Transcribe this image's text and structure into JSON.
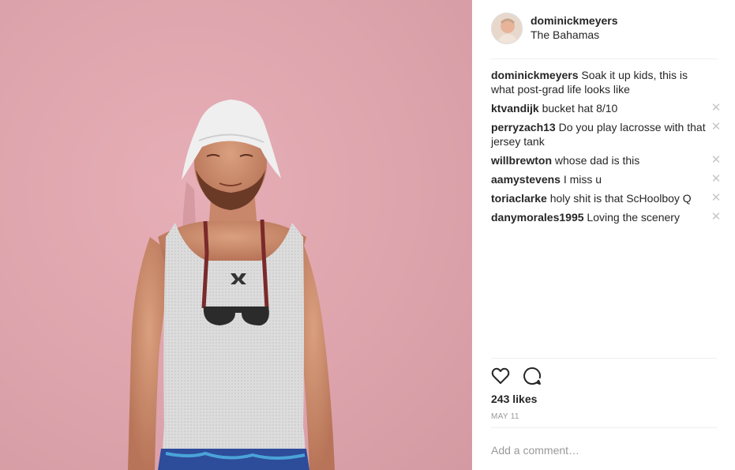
{
  "post": {
    "username": "dominickmeyers",
    "location": "The Bahamas",
    "caption_user": "dominickmeyers",
    "caption_text": "Soak it up kids, this is what post-grad life looks like"
  },
  "comments": [
    {
      "user": "ktvandijk",
      "text": "bucket hat 8/10"
    },
    {
      "user": "perryzach13",
      "text": "Do you play lacrosse with that jersey tank"
    },
    {
      "user": "willbrewton",
      "text": "whose dad is this"
    },
    {
      "user": "aamystevens",
      "text": "I miss u"
    },
    {
      "user": "toriaclarke",
      "text": "holy shit is that ScHoolboy Q"
    },
    {
      "user": "danymorales1995",
      "text": "Loving the scenery"
    }
  ],
  "delete_glyph": "✕",
  "likes": "243 likes",
  "date": "MAY 11",
  "add_comment_placeholder": "Add a comment…",
  "icons": {
    "like": "heart-icon",
    "comment": "comment-bubble-icon",
    "delete": "close-icon"
  },
  "colors": {
    "wall": "#dea4ad",
    "text": "#262626",
    "muted": "#999999",
    "divider": "#efefef",
    "delete": "#c7c7c7"
  }
}
